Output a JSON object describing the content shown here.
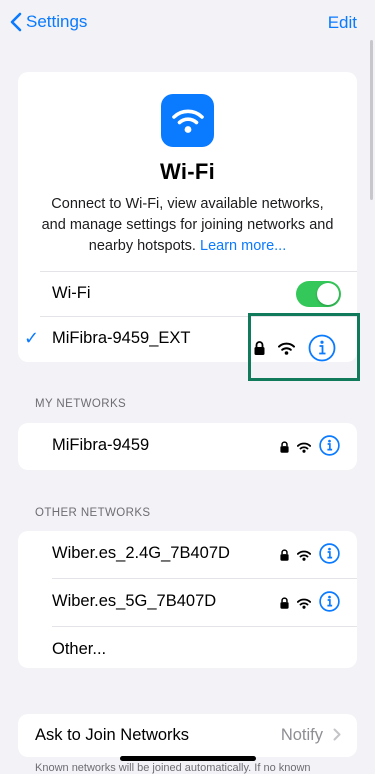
{
  "nav": {
    "back_label": "Settings",
    "edit_label": "Edit"
  },
  "hero": {
    "title": "Wi-Fi",
    "description": "Connect to Wi-Fi, view available networks, and manage settings for joining networks and nearby hotspots.",
    "learn_more": "Learn more..."
  },
  "wifi_toggle": {
    "label": "Wi-Fi",
    "on": true
  },
  "connected": {
    "name": "MiFibra-9459_EXT",
    "secured": true
  },
  "my_networks": {
    "header": "MY NETWORKS",
    "items": [
      {
        "name": "MiFibra-9459",
        "secured": true
      }
    ]
  },
  "other_networks": {
    "header": "OTHER NETWORKS",
    "items": [
      {
        "name": "Wiber.es_2.4G_7B407D",
        "secured": true
      },
      {
        "name": "Wiber.es_5G_7B407D",
        "secured": true
      }
    ],
    "other_label": "Other..."
  },
  "ask_to_join": {
    "label": "Ask to Join Networks",
    "value": "Notify"
  },
  "footer_text": "Known networks will be joined automatically. If no known",
  "colors": {
    "accent": "#0a7aff",
    "toggle_on": "#34c759",
    "highlight": "#117a5a"
  },
  "icons": [
    "chevron-left-icon",
    "wifi-icon",
    "checkmark-icon",
    "lock-icon",
    "info-icon",
    "chevron-right-icon"
  ]
}
